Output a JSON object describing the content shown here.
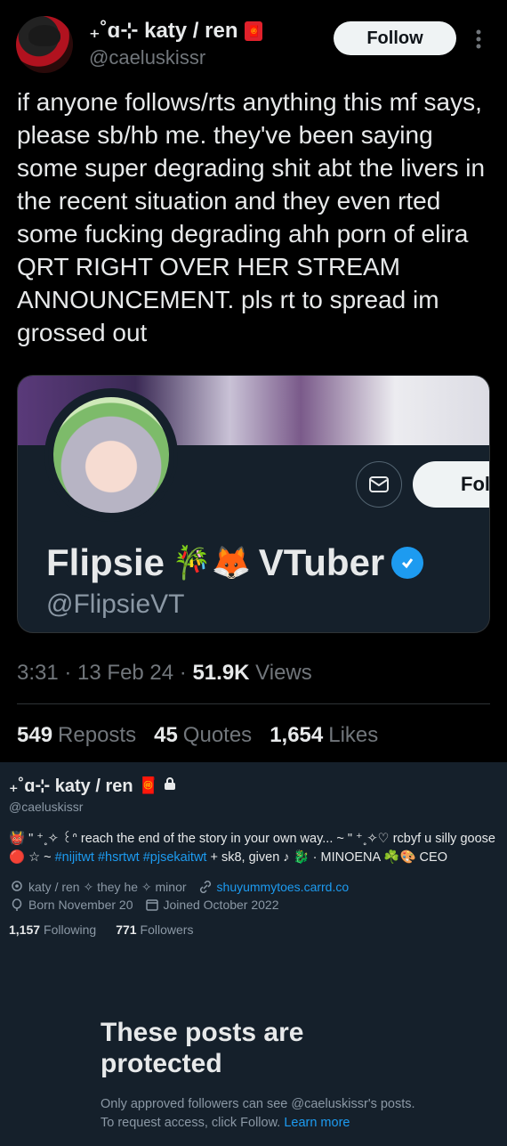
{
  "tweet": {
    "author": {
      "display_name": "₊˚ɑ⊹ katy / ren",
      "badge": "🧧",
      "handle": "@caeluskissr"
    },
    "follow_label": "Follow",
    "more_icon": "more-vertical-icon",
    "text": "if anyone follows/rts anything this mf says, please sb/hb me. they've been saying some super degrading shit abt the livers in the recent situation and they even rted some fucking degrading ahh porn of elira QRT RIGHT OVER HER STREAM ANNOUNCEMENT. pls rt to spread im grossed out",
    "card": {
      "name": "Flipsie",
      "emojis": "🎋🦊",
      "suffix": "VTuber",
      "handle": "@FlipsieVT",
      "follow_label": "Foll",
      "verified": true
    },
    "time": "3:31 · 13 Feb 24 · ",
    "views_count": "51.9K",
    "views_label": " Views",
    "stats": [
      {
        "num": "549",
        "label": "Reposts"
      },
      {
        "num": "45",
        "label": "Quotes"
      },
      {
        "num": "1,654",
        "label": "Likes"
      }
    ]
  },
  "profile": {
    "display_name": "₊˚ɑ⊹ katy / ren",
    "badge": "🧧",
    "lock_icon": "lock-icon",
    "handle": "@caeluskissr",
    "bio_line1": "👹 \" ⁺˳✧ ꒰ᐢ reach the end of the story in your own way... ~ \" ⁺˳✧♡ rcbyf u silly goose",
    "bio_line2_prefix": "🔴 ☆ ~ ",
    "bio_tags": "#nijitwt #hsrtwt #pjsekaitwt",
    "bio_line2_suffix": " + sk8, given ♪ 🐉 · MINOENA ☘️🎨 CEO",
    "location": "katy / ren ✧ they he ✧ minor",
    "website": "shuyummytoes.carrd.co",
    "birthday": "Born November 20",
    "joined": "Joined October 2022",
    "following_count": "1,157",
    "following_label": "Following",
    "followers_count": "771",
    "followers_label": "Followers",
    "protected_title": "These posts are protected",
    "protected_text": "Only approved followers can see @caeluskissr's posts. To request access, click Follow. ",
    "learn_more": "Learn more"
  },
  "colors": {
    "accent": "#1d9bf0",
    "profile_bg": "#15202b",
    "tweet_bg": "#000000"
  }
}
